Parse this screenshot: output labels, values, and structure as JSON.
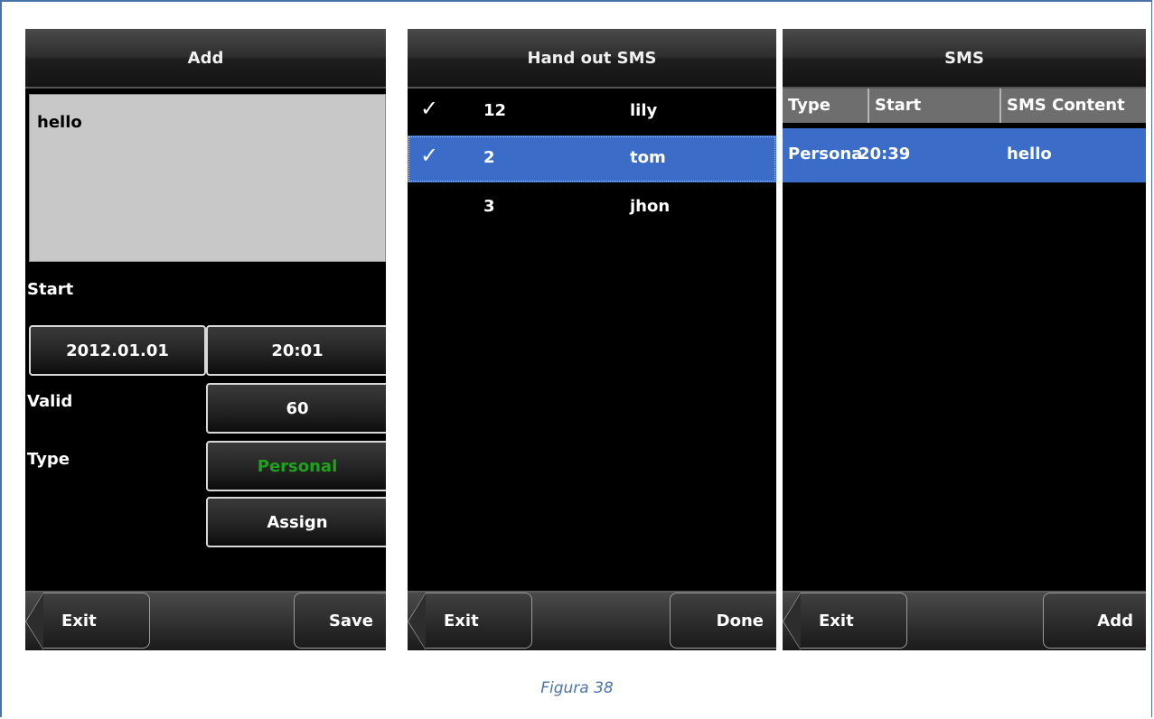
{
  "screens": {
    "add": {
      "title": "Add",
      "message_text": "hello",
      "start_label": "Start",
      "start_date": "2012.01.01",
      "start_time": "20:01",
      "valid_label": "Valid",
      "valid_value": "60",
      "type_label": "Type",
      "type_value": "Personal",
      "assign_label": "Assign",
      "exit_label": "Exit",
      "save_label": "Save"
    },
    "hand_out": {
      "title": "Hand out SMS",
      "rows": [
        {
          "check": "✓",
          "id": "12",
          "name": "lily"
        },
        {
          "check": "✓",
          "id": "2",
          "name": "tom"
        },
        {
          "check": "",
          "id": "3",
          "name": "jhon"
        }
      ],
      "exit_label": "Exit",
      "done_label": "Done"
    },
    "sms": {
      "title": "SMS",
      "columns": [
        "Type",
        "Start",
        "SMS Content"
      ],
      "rows": [
        {
          "type": "Persona",
          "start": "20:39",
          "content": "hello"
        }
      ],
      "exit_label": "Exit",
      "add_label": "Add"
    }
  },
  "caption": "Figura 38",
  "colors": {
    "selection": "#3b6cc8",
    "type_value_text": "#1fa01f",
    "frame": "#4a74a8"
  }
}
